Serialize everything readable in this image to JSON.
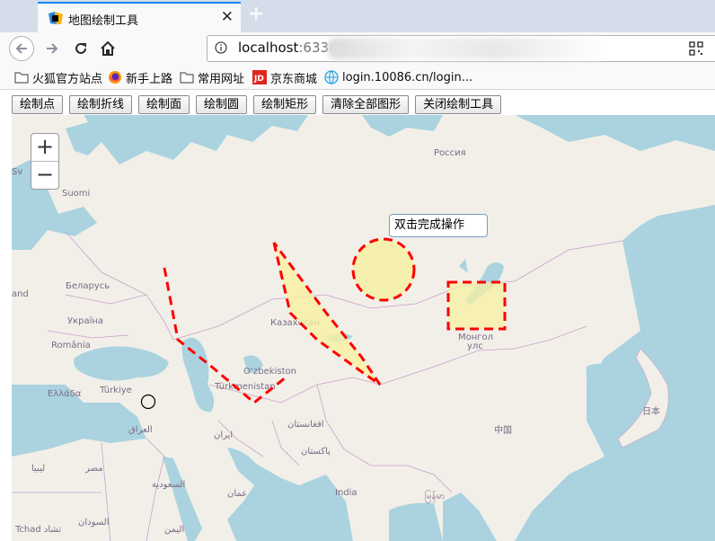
{
  "browser": {
    "tab_title": "地图绘制工具",
    "url_host": "localhost",
    "url_port": ":63342"
  },
  "bookmarks": [
    {
      "label": "火狐官方站点",
      "icon": "folder-icon"
    },
    {
      "label": "新手上路",
      "icon": "firefox-icon"
    },
    {
      "label": "常用网址",
      "icon": "folder-icon"
    },
    {
      "label": "京东商城",
      "icon": "jd-icon"
    },
    {
      "label": "login.10086.cn/login...",
      "icon": "globe-icon"
    }
  ],
  "toolbar": {
    "draw_point": "绘制点",
    "draw_polyline": "绘制折线",
    "draw_polygon": "绘制面",
    "draw_circle": "绘制圆",
    "draw_rectangle": "绘制矩形",
    "clear_all": "清除全部图形",
    "close_tool": "关闭绘制工具"
  },
  "map": {
    "zoom_in": "+",
    "zoom_out": "−",
    "tooltip": "双击完成操作",
    "labels": {
      "russia": "Россия",
      "suomi": "Suomi",
      "belarus": "Беларусь",
      "ukraine": "Україна",
      "romania": "România",
      "turkiye": "Türkiye",
      "greece": "Ελλάδα",
      "kazakhstan": "Казахстан",
      "uzbekistan": "O‘zbekiston",
      "turkmenistan": "Türkmenistan",
      "mongolia_1": "Монгол",
      "mongolia_2": "улс",
      "china": "中国",
      "japan": "日本",
      "iraq": "العراق",
      "iran": "ایران",
      "afghanistan": "افغانستان",
      "pakistan": "پاکستان",
      "india": "India",
      "myanmar": "မြန်မာ",
      "libya": "ليبيا",
      "egypt": "مصر",
      "saudi": "السعودية",
      "oman": "عمان",
      "yemen": "اليمن",
      "sudan": "السودان",
      "chad": "Tchad تشاد",
      "sv": "Sv",
      "land": "and"
    }
  },
  "colors": {
    "water": "#aad3df",
    "land": "#f2efe9",
    "drawing_stroke": "#ff0000",
    "drawing_fill": "#f7f0a3",
    "tab_accent": "#0a84ff"
  }
}
